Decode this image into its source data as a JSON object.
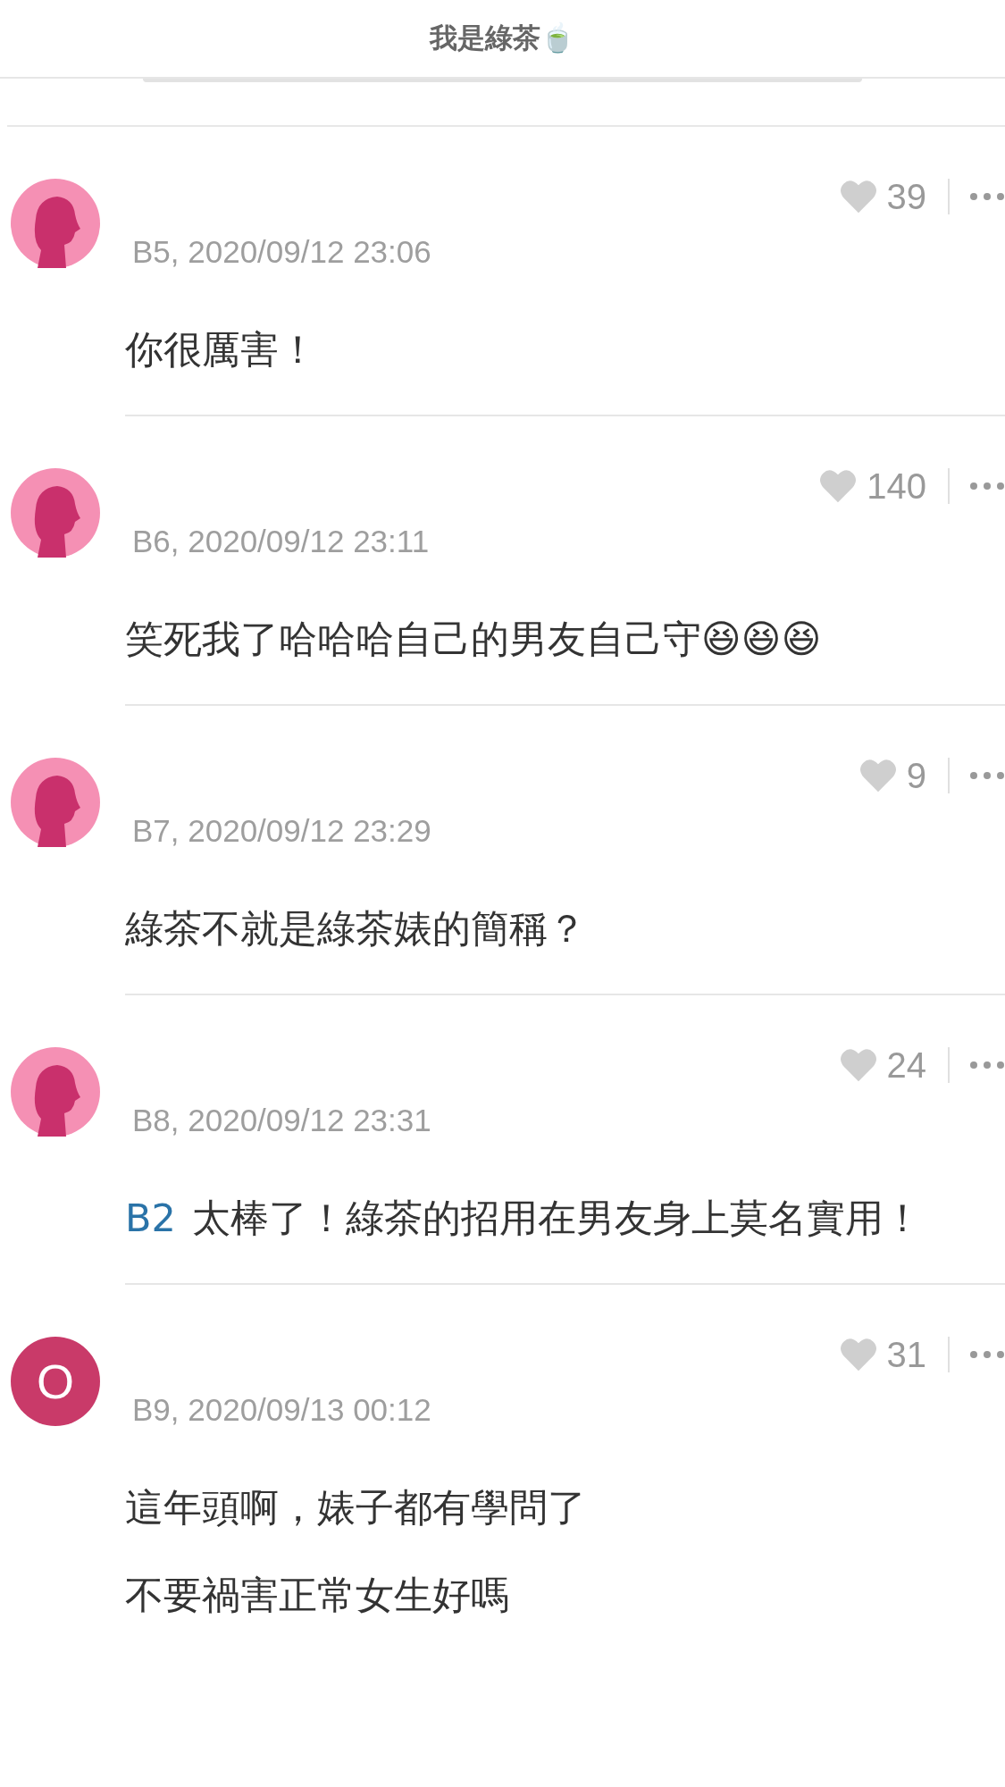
{
  "header": {
    "title": "我是綠茶🍵"
  },
  "comments": [
    {
      "avatar": {
        "kind": "silhouette"
      },
      "floor": "B5, 2020/09/12 23:06",
      "likes": "39",
      "body": [
        {
          "kind": "text",
          "text": "你很厲害！"
        }
      ]
    },
    {
      "avatar": {
        "kind": "silhouette"
      },
      "floor": "B6, 2020/09/12 23:11",
      "likes": "140",
      "body": [
        {
          "kind": "text",
          "text": "笑死我了哈哈哈自己的男友自己守😆😆😆"
        }
      ]
    },
    {
      "avatar": {
        "kind": "silhouette"
      },
      "floor": "B7, 2020/09/12 23:29",
      "likes": "9",
      "body": [
        {
          "kind": "text",
          "text": "綠茶不就是綠茶婊的簡稱？"
        }
      ]
    },
    {
      "avatar": {
        "kind": "silhouette"
      },
      "floor": "B8, 2020/09/12 23:31",
      "likes": "24",
      "body": [
        {
          "kind": "mention",
          "text": "B2"
        },
        {
          "kind": "text",
          "text": "太棒了！綠茶的招用在男友身上莫名實用！"
        }
      ]
    },
    {
      "avatar": {
        "kind": "letter",
        "letter": "O"
      },
      "floor": "B9, 2020/09/13 00:12",
      "likes": "31",
      "body": [
        {
          "kind": "text",
          "text": "這年頭啊，婊子都有學問了"
        },
        {
          "kind": "text",
          "text": "不要禍害正常女生好嗎"
        }
      ]
    }
  ]
}
